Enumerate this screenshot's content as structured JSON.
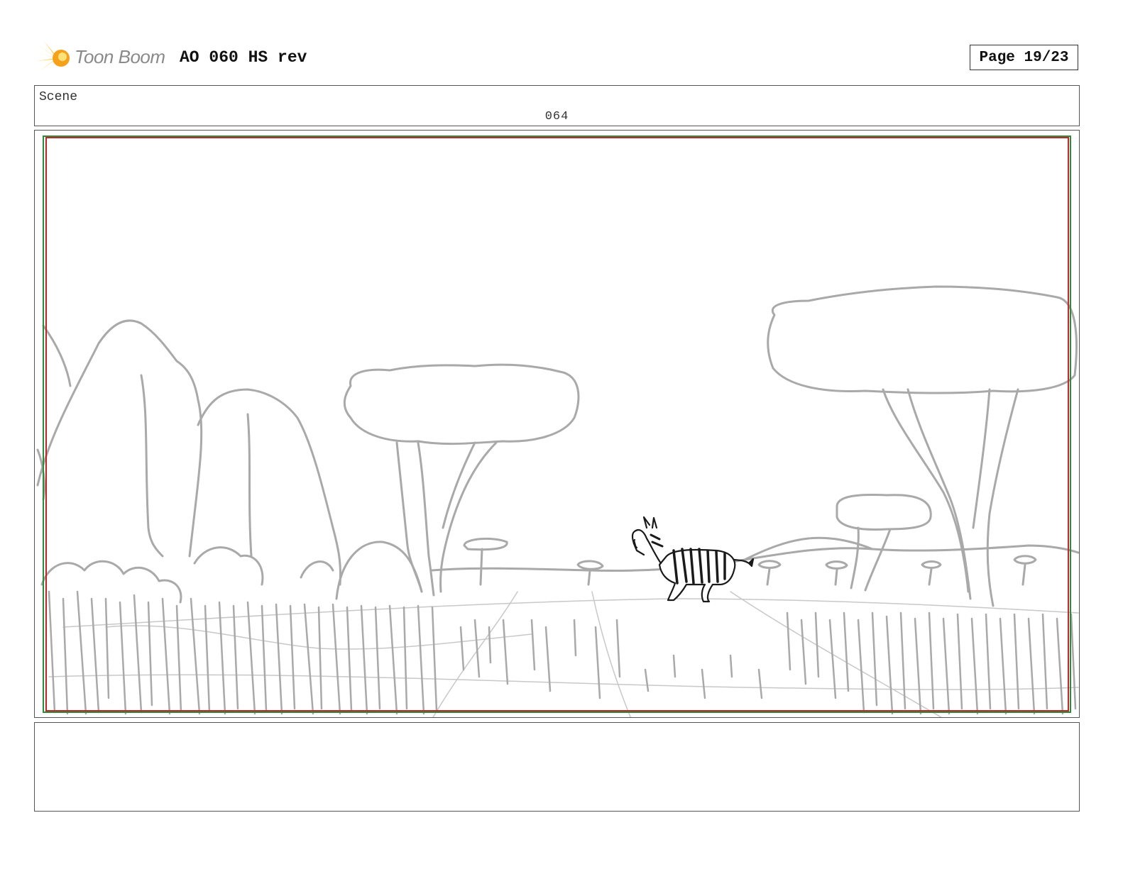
{
  "header": {
    "logo_text": "Toon Boom",
    "title": "AO 060 HS rev",
    "page_label": "Page 19/23"
  },
  "scene": {
    "label": "Scene",
    "number": "064"
  },
  "colors": {
    "frame_red": "#c0272d",
    "frame_green": "#2e8b3a",
    "sketch_grey": "#a9a9a9",
    "logo_yellow": "#f7c21a"
  }
}
